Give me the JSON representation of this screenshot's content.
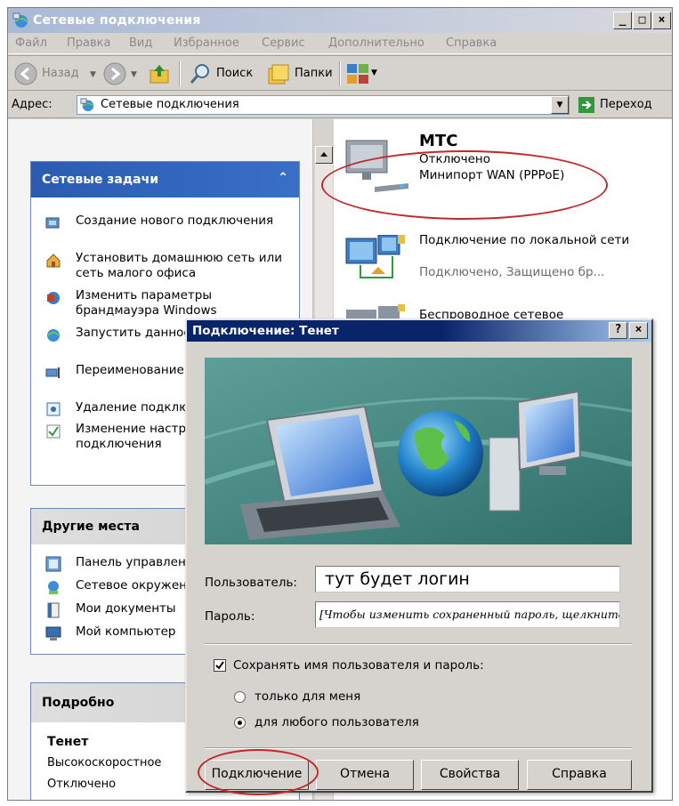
{
  "window": {
    "title": "Сетевые подключения",
    "minimize": "_",
    "maximize": "□",
    "close": "×"
  },
  "menu": [
    "Файл",
    "Правка",
    "Вид",
    "Избранное",
    "Сервис",
    "Дополнительно",
    "Справка"
  ],
  "toolbar": {
    "back": "Назад",
    "search": "Поиск",
    "folders": "Папки"
  },
  "address": {
    "label": "Адрес:",
    "value": "Сетевые подключения",
    "go": "Переход"
  },
  "left": {
    "network_tasks": {
      "title": "Сетевые задачи",
      "items": [
        "Создание нового подключения",
        "Установить домашнюю сеть или сеть малого офиса",
        "Изменить параметры брандмауэра Windows",
        "Запустить данное соединение",
        "Переименование подключения",
        "Удаление подключения",
        "Изменение настроек подключения"
      ]
    },
    "other_places": {
      "title": "Другие места",
      "items": [
        "Панель управления",
        "Сетевое окружение",
        "Мои документы",
        "Мой компьютер"
      ]
    },
    "details": {
      "title": "Подробно",
      "name": "Тенет",
      "type": "Высокоскоростное",
      "status": "Отключено"
    }
  },
  "connections": [
    {
      "name": "МТС",
      "status": "Отключено",
      "device": "Минипорт WAN (PPPoE)"
    },
    {
      "name": "Подключение по локальной сети",
      "status": "Подключено, Защищено бр..."
    },
    {
      "name": "Беспроводное сетевое"
    }
  ],
  "dialog": {
    "title": "Подключение: Тенет",
    "help": "?",
    "close": "×",
    "user_label": "Пользователь:",
    "user_value": "тут будет логин",
    "password_label": "Пароль:",
    "password_value": "[Чтобы изменить сохраненный пароль, щелкните здесь]",
    "save_label": "Сохранять имя пользователя и пароль:",
    "save_checked": true,
    "only_me": "только для меня",
    "any_user": "для любого пользователя",
    "selected": "any_user",
    "buttons": {
      "connect": "Подключение",
      "cancel": "Отмена",
      "properties": "Свойства",
      "help": "Справка"
    }
  },
  "colors": {
    "annotation": "#c0282c",
    "task_header": "#2a5bb1",
    "dialog_title": "#0a246a"
  }
}
